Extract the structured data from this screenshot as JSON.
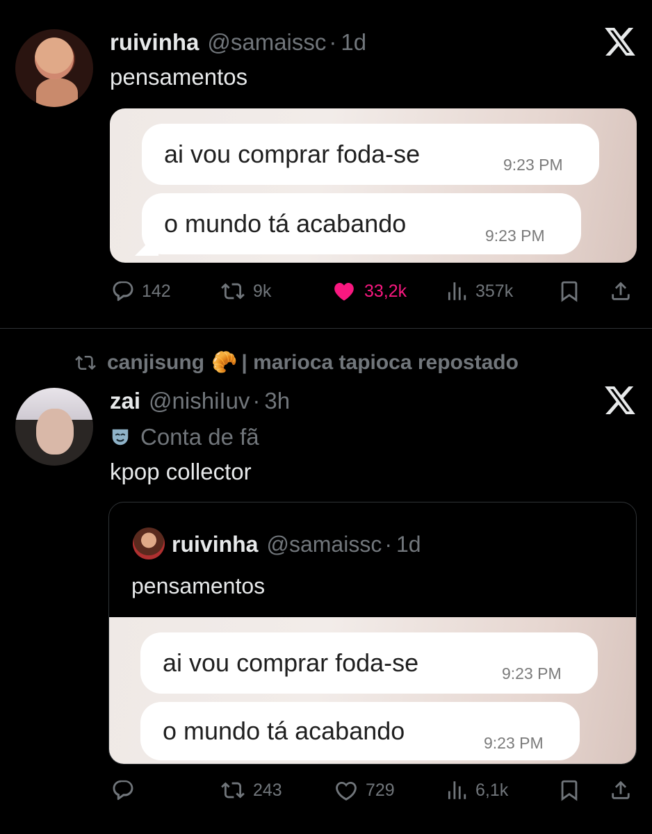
{
  "tweet1": {
    "name": "ruivinha",
    "handle": "@samaissc",
    "dot": "·",
    "time": "1d",
    "text": "pensamentos",
    "bubbles": [
      {
        "text": "ai vou comprar foda-se",
        "time": "9:23 PM"
      },
      {
        "text": "o mundo tá acabando",
        "time": "9:23 PM"
      }
    ],
    "actions": {
      "replies": "142",
      "reposts": "9k",
      "likes": "33,2k",
      "views": "357k"
    }
  },
  "tweet2": {
    "repost_by": "canjisung",
    "repost_emoji": "🥐",
    "repost_suffix": "| marioca tapioca repostado",
    "name": "zai",
    "handle": "@nishiIuv",
    "dot": "·",
    "time": "3h",
    "fan_label": "Conta de fã",
    "text": "kpop collector",
    "quote": {
      "name": "ruivinha",
      "handle": "@samaissc",
      "dot": "·",
      "time": "1d",
      "text": "pensamentos",
      "bubbles": [
        {
          "text": "ai vou comprar foda-se",
          "time": "9:23 PM"
        },
        {
          "text": "o mundo tá acabando",
          "time": "9:23 PM"
        }
      ]
    },
    "actions": {
      "replies": "",
      "reposts": "243",
      "likes": "729",
      "views": "6,1k"
    }
  },
  "icons": [
    "x-logo-icon",
    "reply-icon",
    "repost-icon",
    "heart-icon",
    "views-icon",
    "bookmark-icon",
    "share-icon",
    "theater-mask-icon"
  ],
  "colors": {
    "background": "#000000",
    "text": "#e7e9ea",
    "muted": "#71767b",
    "like": "#f91880",
    "divider": "#2f3336"
  }
}
